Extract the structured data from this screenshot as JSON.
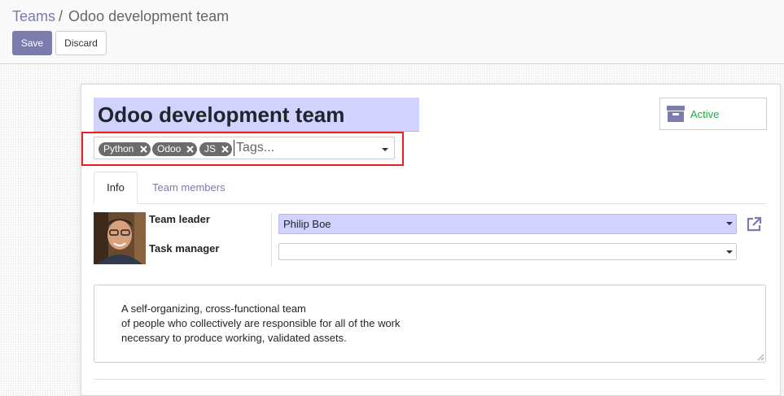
{
  "breadcrumb": {
    "parent": "Teams",
    "separator": "/",
    "current": "Odoo development team"
  },
  "toolbar": {
    "save_label": "Save",
    "discard_label": "Discard"
  },
  "record": {
    "name": "Odoo development team"
  },
  "status_button": {
    "label": "Active",
    "icon": "archive-icon"
  },
  "tags": {
    "items": [
      {
        "label": "Python"
      },
      {
        "label": "Odoo"
      },
      {
        "label": "JS"
      }
    ],
    "placeholder": "Tags..."
  },
  "tabs": [
    {
      "label": "Info",
      "active": true
    },
    {
      "label": "Team members",
      "active": false
    }
  ],
  "fields": {
    "team_leader": {
      "label": "Team leader",
      "value": "Philip Boe"
    },
    "task_manager": {
      "label": "Task manager",
      "value": ""
    }
  },
  "description": {
    "lines": [
      "A self-organizing, cross-functional team",
      "of people who collectively are responsible for all of the work",
      "necessary to produce working, validated assets."
    ]
  },
  "colors": {
    "brand": "#7c7bad",
    "required_field_bg": "#d2d2ff",
    "active_status": "#28a745",
    "highlight_box": "#ee1c25",
    "tag_bg": "#6b6b6b"
  }
}
